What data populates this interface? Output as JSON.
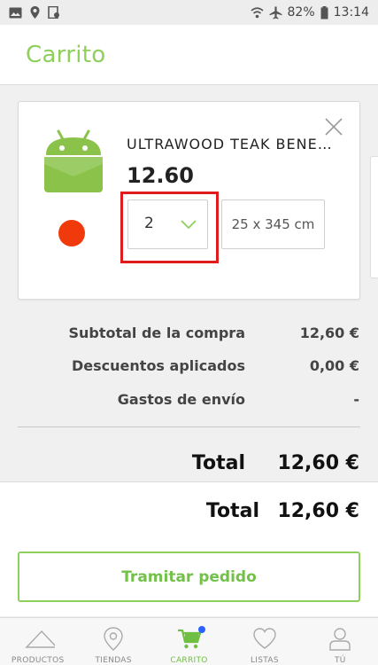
{
  "status_bar": {
    "battery": "82%",
    "time": "13:14"
  },
  "header": {
    "title": "Carrito"
  },
  "product": {
    "name": "ULTRAWOOD TEAK BENEV...",
    "price": "12.60",
    "quantity": "2",
    "size": "25 x 345 cm",
    "color_swatch": "#f03a0c"
  },
  "summary": {
    "subtotal_label": "Subtotal de la compra",
    "subtotal_value": "12,60 €",
    "discount_label": "Descuentos aplicados",
    "discount_value": "0,00 €",
    "shipping_label": "Gastos de envío",
    "shipping_value": "-",
    "total_label": "Total",
    "total_value": "12,60 €"
  },
  "footer": {
    "total_label": "Total",
    "total_value": "12,60 €",
    "checkout_label": "Tramitar pedido"
  },
  "nav": {
    "items": [
      {
        "label": "PRODUCTOS",
        "icon": "triangle-icon"
      },
      {
        "label": "TIENDAS",
        "icon": "location-pin-icon"
      },
      {
        "label": "CARRITO",
        "icon": "cart-icon"
      },
      {
        "label": "LISTAS",
        "icon": "heart-icon"
      },
      {
        "label": "TÚ",
        "icon": "user-icon"
      }
    ],
    "active": "CARRITO"
  },
  "colors": {
    "accent_green": "#8fcf5b",
    "highlight_red": "#e01b1b",
    "badge_blue": "#2962ff"
  }
}
